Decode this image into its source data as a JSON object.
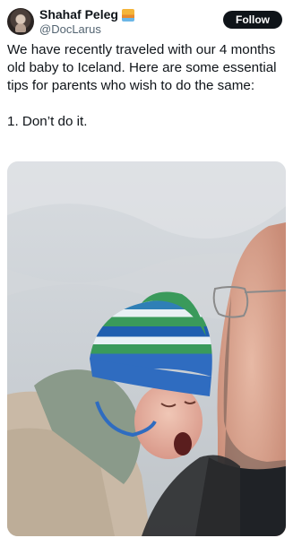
{
  "user": {
    "display_name": "Shahaf Peleg",
    "handle": "@DocLarus"
  },
  "follow_label": "Follow",
  "post": {
    "text": "We have recently traveled with our 4 months old baby to Iceland. Here are some essential tips for parents who wish to do the same:\n\n1. Don’t do it."
  },
  "icons": {
    "avatar": "profile-avatar",
    "badge": "sunset-emoji-icon"
  },
  "colors": {
    "text_primary": "#0f1419",
    "text_secondary": "#536471",
    "button_bg": "#0f1419",
    "button_text": "#ffffff"
  }
}
